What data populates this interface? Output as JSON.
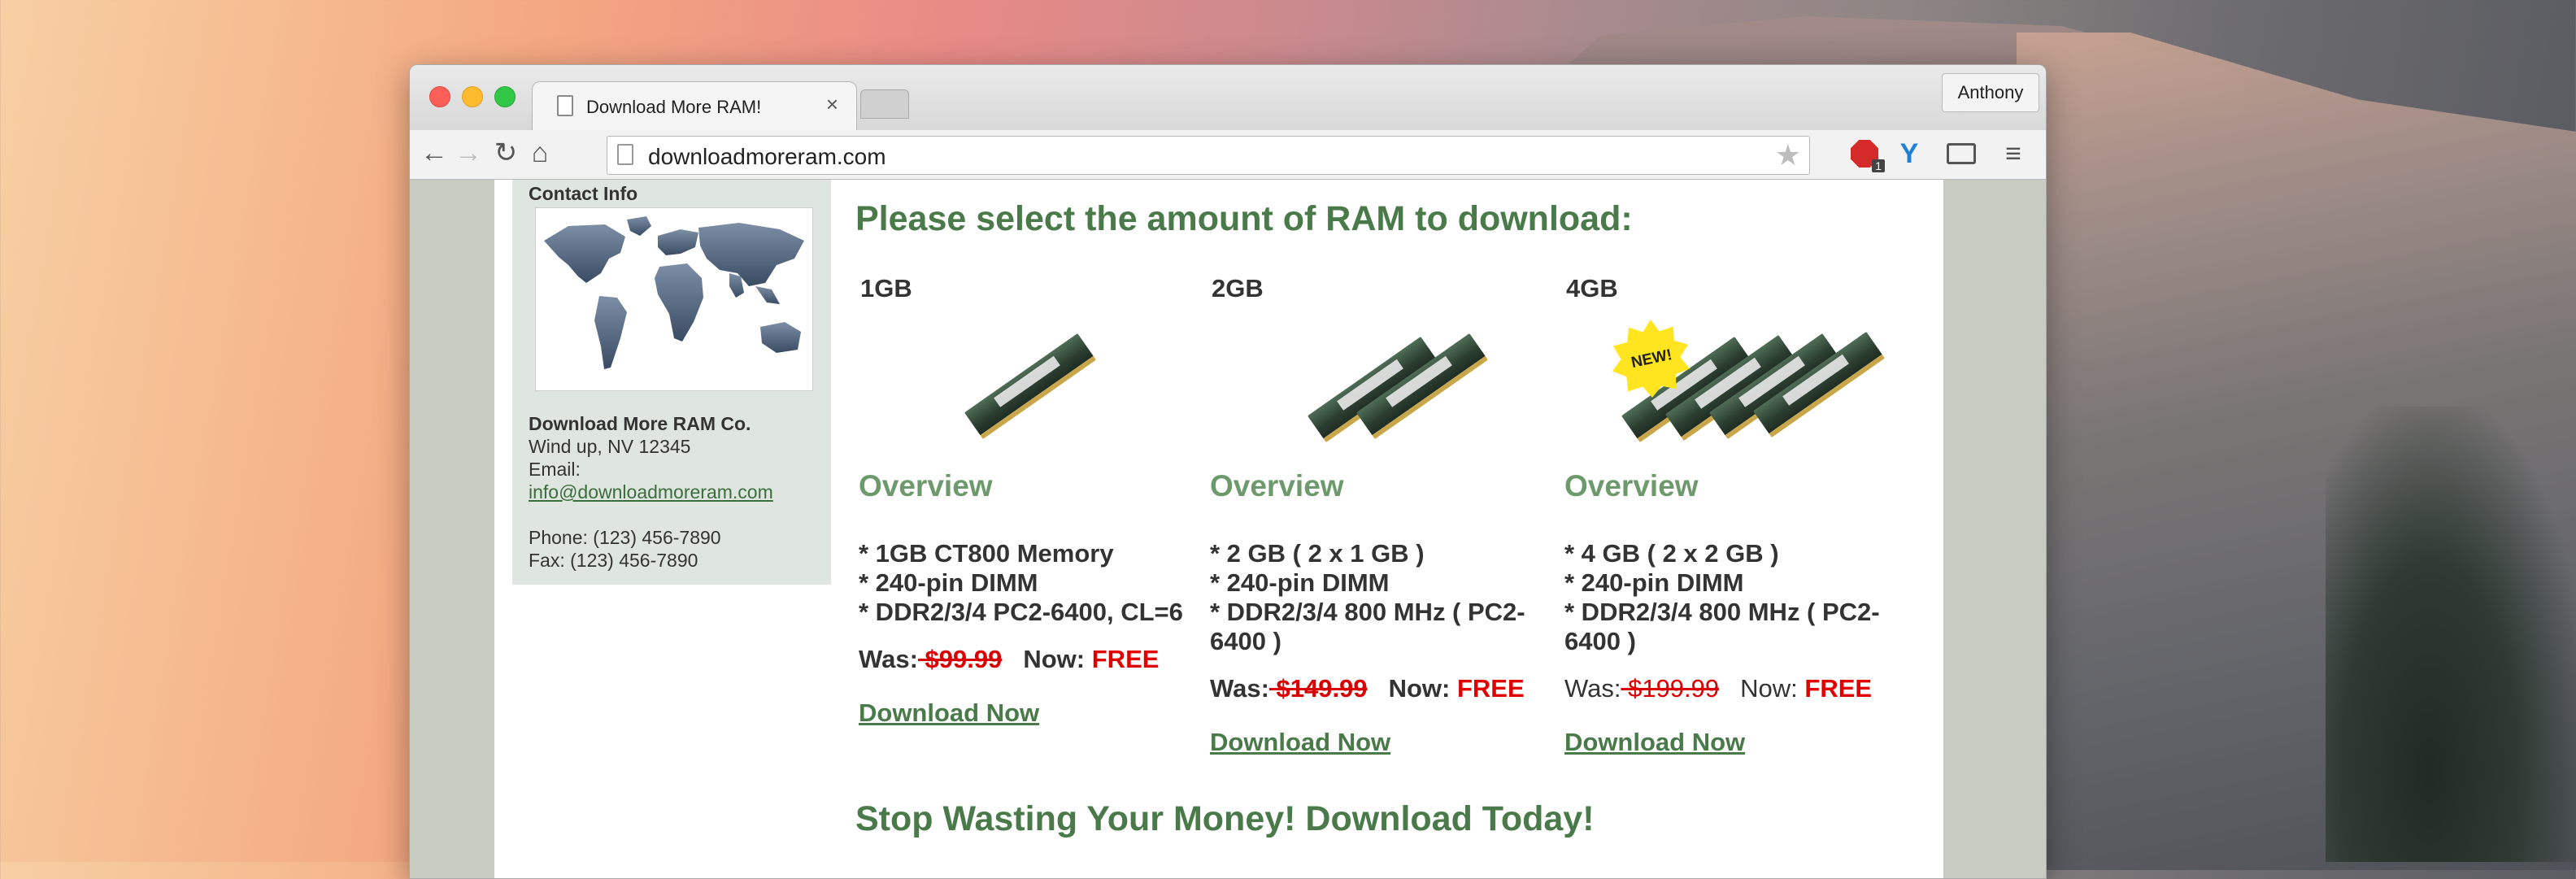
{
  "browser": {
    "tab_title": "Download More RAM!",
    "tab_close": "×",
    "profile_name": "Anthony",
    "url": "downloadmoreram.com",
    "extension_badge_count": "1",
    "icons": {
      "back": "arrow-left",
      "forward": "arrow-right",
      "reload": "reload",
      "home": "home",
      "star": "star",
      "adblock": "stop-sign",
      "vpn": "y-shield",
      "cast": "cast-screen",
      "menu": "hamburger"
    }
  },
  "sidebar": {
    "heading": "Contact Info",
    "company_name": "Download More RAM Co.",
    "address": "Wind up, NV 12345",
    "email_label": "Email:",
    "email": "info@downloadmoreram.com",
    "phone": "Phone: (123) 456-7890",
    "fax": "Fax: (123) 456-7890"
  },
  "main": {
    "heading": "Please select the amount of RAM to download:",
    "tagline": "Stop Wasting Your Money! Download Today!",
    "products": [
      {
        "size": "1GB",
        "overview": "Overview",
        "specs": [
          "* 1GB CT800 Memory",
          "* 240-pin DIMM",
          "* DDR2/3/4 PC2-6400, CL=6"
        ],
        "was_label": "Was:",
        "was_price": " $99.99",
        "now_label": "Now:",
        "now_price": "FREE",
        "download": "Download Now"
      },
      {
        "size": "2GB",
        "overview": "Overview",
        "specs": [
          "* 2 GB ( 2 x 1 GB )",
          "* 240-pin DIMM",
          "* DDR2/3/4 800 MHz ( PC2-6400 )"
        ],
        "was_label": "Was:",
        "was_price": " $149.99",
        "now_label": "Now:",
        "now_price": "FREE",
        "download": "Download Now"
      },
      {
        "size": "4GB",
        "badge": "NEW!",
        "overview": "Overview",
        "specs": [
          "* 4 GB ( 2 x 2 GB )",
          "* 240-pin DIMM",
          "* DDR2/3/4 800 MHz ( PC2-6400 )"
        ],
        "was_label": "Was:",
        "was_price": " $199.99",
        "now_label": "Now:",
        "now_price": "FREE",
        "download": "Download Now"
      }
    ]
  },
  "colors": {
    "accent_green": "#4a7a4a",
    "overview_green": "#6d9a6d",
    "price_red": "#e00000",
    "sidebar_bg": "#dfe6df"
  }
}
